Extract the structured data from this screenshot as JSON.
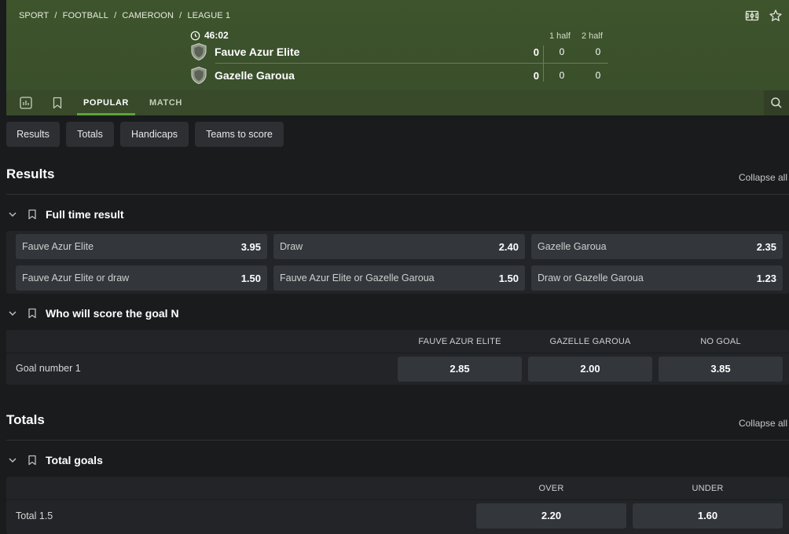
{
  "breadcrumb": [
    "SPORT",
    "/",
    "FOOTBALL",
    "/",
    "CAMEROON",
    "/",
    "LEAGUE 1"
  ],
  "match": {
    "time": "46:02",
    "half1_label": "1 half",
    "half2_label": "2 half",
    "teams": [
      {
        "name": "Fauve Azur Elite",
        "score": "0",
        "half1": "0",
        "half2": "0"
      },
      {
        "name": "Gazelle Garoua",
        "score": "0",
        "half1": "0",
        "half2": "0"
      }
    ]
  },
  "nav": {
    "tabs": [
      {
        "label": "POPULAR",
        "active": true
      },
      {
        "label": "MATCH",
        "active": false
      }
    ],
    "icons": [
      "stats-icon",
      "bookmark-icon",
      "search-icon"
    ]
  },
  "filters": [
    "Results",
    "Totals",
    "Handicaps",
    "Teams to score"
  ],
  "sections": {
    "results": {
      "title": "Results",
      "collapse_label": "Collapse all",
      "full_time": {
        "title": "Full time result",
        "odds": [
          {
            "label": "Fauve Azur Elite",
            "value": "3.95"
          },
          {
            "label": "Draw",
            "value": "2.40"
          },
          {
            "label": "Gazelle Garoua",
            "value": "2.35"
          },
          {
            "label": "Fauve Azur Elite or draw",
            "value": "1.50"
          },
          {
            "label": "Fauve Azur Elite or Gazelle Garoua",
            "value": "1.50"
          },
          {
            "label": "Draw or Gazelle Garoua",
            "value": "1.23"
          }
        ]
      },
      "who_scores": {
        "title": "Who will score the goal N",
        "columns": [
          "FAUVE AZUR ELITE",
          "GAZELLE GAROUA",
          "NO GOAL"
        ],
        "rows": [
          {
            "label": "Goal number 1",
            "values": [
              "2.85",
              "2.00",
              "3.85"
            ]
          }
        ]
      }
    },
    "totals": {
      "title": "Totals",
      "collapse_label": "Collapse all",
      "total_goals": {
        "title": "Total goals",
        "columns": [
          "OVER",
          "UNDER"
        ],
        "rows": [
          {
            "label": "Total 1.5",
            "values": [
              "2.20",
              "1.60"
            ]
          }
        ]
      }
    }
  },
  "colors": {
    "header_bg": "#3b4f2b",
    "accent": "#5aa53a",
    "page_bg": "#1a1b1d",
    "button_bg": "#33363b"
  }
}
